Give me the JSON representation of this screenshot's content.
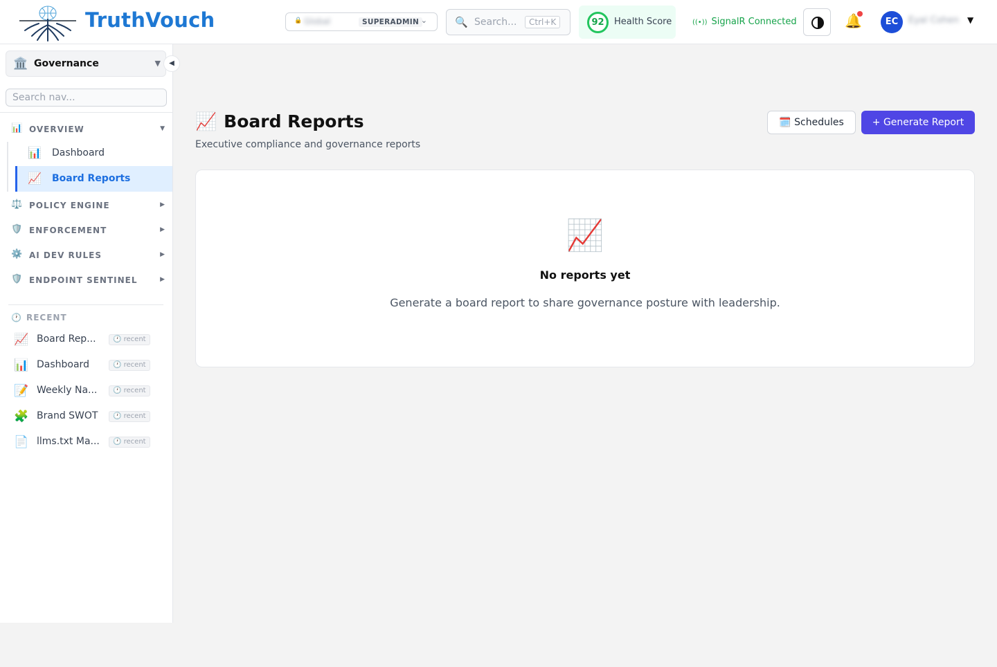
{
  "app": {
    "brand": "TruthVouch"
  },
  "header": {
    "tenant": {
      "name": "Global",
      "role": "SUPERADMIN"
    },
    "search": {
      "placeholder": "Search...",
      "shortcut": "Ctrl+K"
    },
    "health": {
      "score": "92",
      "label": "Health Score"
    },
    "connection": {
      "status": "SignalR Connected",
      "color": "#16a34a"
    },
    "user": {
      "initials": "EC",
      "name": "Eyal Cohen"
    }
  },
  "sidebar": {
    "workspace": {
      "icon": "🏛️",
      "label": "Governance"
    },
    "search_placeholder": "Search nav...",
    "sections": [
      {
        "icon": "📊",
        "label": "OVERVIEW",
        "expanded": true
      },
      {
        "icon": "⚖️",
        "label": "POLICY ENGINE",
        "expanded": false
      },
      {
        "icon": "🛡️",
        "label": "ENFORCEMENT",
        "expanded": false
      },
      {
        "icon": "⚙️",
        "label": "AI DEV RULES",
        "expanded": false
      },
      {
        "icon": "🛡️",
        "label": "ENDPOINT SENTINEL",
        "expanded": false
      }
    ],
    "overview_items": [
      {
        "icon": "📊",
        "label": "Dashboard",
        "active": false
      },
      {
        "icon": "📈",
        "label": "Board Reports",
        "active": true
      }
    ],
    "recent_title": "RECENT",
    "recent": [
      {
        "icon": "📈",
        "label": "Board Rep...",
        "tag": "recent"
      },
      {
        "icon": "📊",
        "label": "Dashboard",
        "tag": "recent"
      },
      {
        "icon": "📝",
        "label": "Weekly Na...",
        "tag": "recent"
      },
      {
        "icon": "🧩",
        "label": "Brand SWOT",
        "tag": "recent"
      },
      {
        "icon": "📄",
        "label": "llms.txt Ma...",
        "tag": "recent"
      }
    ]
  },
  "main": {
    "title_icon": "📈",
    "title": "Board Reports",
    "subtitle": "Executive compliance and governance reports",
    "schedules_icon": "🗓️",
    "schedules_label": "Schedules",
    "generate_label": "+ Generate Report",
    "empty": {
      "icon": "📈",
      "title": "No reports yet",
      "description": "Generate a board report to share governance posture with leadership."
    }
  },
  "colors": {
    "brand": "#1e78d3",
    "primary_button": "#4f46e5",
    "active_nav": "#1d6fe0"
  }
}
